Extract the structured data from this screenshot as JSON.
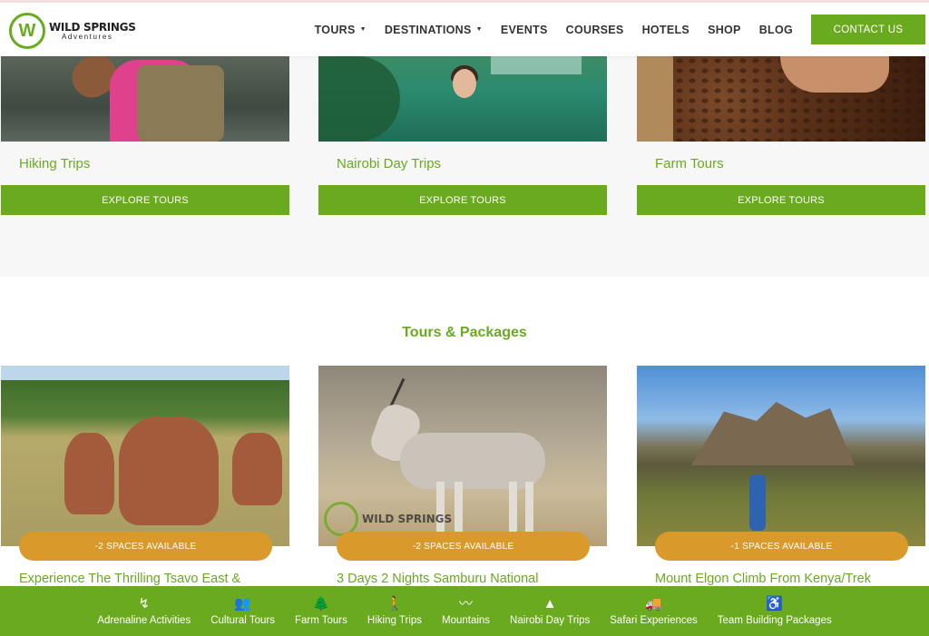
{
  "header": {
    "logo_name": "WILD SPRINGS",
    "logo_sub": "Adventures",
    "nav": [
      {
        "label": "TOURS",
        "dropdown": true
      },
      {
        "label": "DESTINATIONS",
        "dropdown": true
      },
      {
        "label": "EVENTS",
        "dropdown": false
      },
      {
        "label": "COURSES",
        "dropdown": false
      },
      {
        "label": "HOTELS",
        "dropdown": false
      },
      {
        "label": "SHOP",
        "dropdown": false
      },
      {
        "label": "BLOG",
        "dropdown": false
      }
    ],
    "contact_label": "CONTACT US"
  },
  "categories": [
    {
      "title": "Hiking Trips",
      "button": "EXPLORE TOURS"
    },
    {
      "title": "Nairobi Day Trips",
      "button": "EXPLORE TOURS"
    },
    {
      "title": "Farm Tours",
      "button": "EXPLORE TOURS"
    }
  ],
  "tours_section": {
    "title": "Tours & Packages",
    "tours": [
      {
        "spaces": "-2 SPACES AVAILABLE",
        "title": "Experience The Thrilling Tsavo East &"
      },
      {
        "spaces": "-2 SPACES AVAILABLE",
        "title": "3 Days 2 Nights Samburu National"
      },
      {
        "spaces": "-1 SPACES AVAILABLE",
        "title": "Mount Elgon Climb From Kenya/Trek"
      }
    ],
    "watermark": "WILD SPRINGS"
  },
  "bottom_bar": [
    {
      "label": "Adrenaline Activities",
      "icon": "lightning-icon",
      "glyph": "↯"
    },
    {
      "label": "Cultural Tours",
      "icon": "people-icon",
      "glyph": "👥"
    },
    {
      "label": "Farm Tours",
      "icon": "tree-icon",
      "glyph": "🌲"
    },
    {
      "label": "Hiking Trips",
      "icon": "hiker-icon",
      "glyph": "🚶"
    },
    {
      "label": "Mountains",
      "icon": "mountain-icon",
      "glyph": "〰"
    },
    {
      "label": "Nairobi Day Trips",
      "icon": "road-icon",
      "glyph": "▲"
    },
    {
      "label": "Safari Experiences",
      "icon": "truck-icon",
      "glyph": "🚚"
    },
    {
      "label": "Team Building Packages",
      "icon": "accessibility-icon",
      "glyph": "♿"
    }
  ],
  "colors": {
    "brand_green": "#6aaa1f",
    "badge_orange": "#d99a2b"
  }
}
